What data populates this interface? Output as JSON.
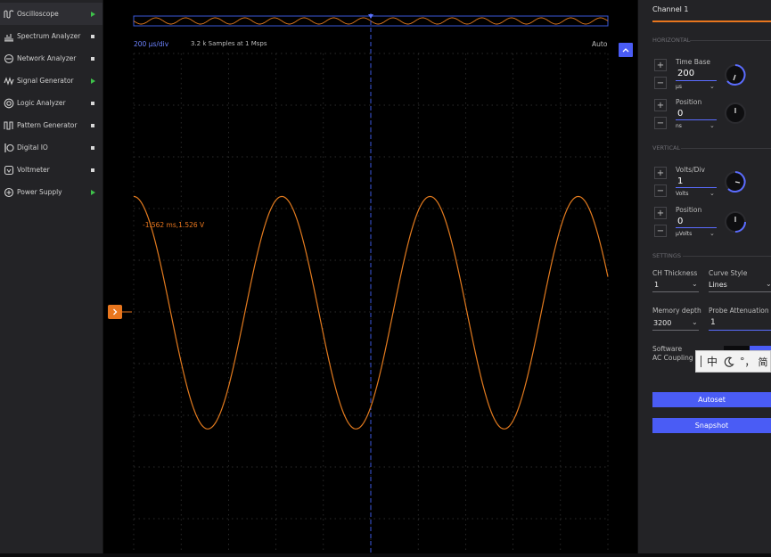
{
  "sidebar": {
    "items": [
      {
        "label": "Oscilloscope",
        "icon": "oscilloscope-icon",
        "status": "running"
      },
      {
        "label": "Spectrum Analyzer",
        "icon": "spectrum-icon",
        "status": "stopped"
      },
      {
        "label": "Network Analyzer",
        "icon": "network-icon",
        "status": "stopped"
      },
      {
        "label": "Signal Generator",
        "icon": "signal-generator-icon",
        "status": "running"
      },
      {
        "label": "Logic Analyzer",
        "icon": "logic-analyzer-icon",
        "status": "stopped"
      },
      {
        "label": "Pattern Generator",
        "icon": "pattern-generator-icon",
        "status": "stopped"
      },
      {
        "label": "Digital IO",
        "icon": "digital-io-icon",
        "status": "stopped"
      },
      {
        "label": "Voltmeter",
        "icon": "voltmeter-icon",
        "status": "stopped"
      },
      {
        "label": "Power Supply",
        "icon": "power-supply-icon",
        "status": "running"
      }
    ]
  },
  "plot": {
    "time_div": "200 µs/div",
    "samples": "3.2 k Samples at 1 Msps",
    "trigger_mode": "Auto",
    "cursor_readout": "-1.562 ms,1.526 V",
    "colors": {
      "trace": "#e27a1e",
      "accent": "#4a5cf5",
      "marker": "#e8761e"
    },
    "waveform": {
      "periods_in_view": 3.2,
      "phase_fraction": 0.5,
      "amplitude_fraction": 0.42,
      "center_fraction": 0.565
    }
  },
  "panel": {
    "title": "Channel 1",
    "horizontal": {
      "header": "HORIZONTAL",
      "time_base_label": "Time Base",
      "time_base_value": "200",
      "time_base_unit": "µs",
      "position_label": "Position",
      "position_value": "0",
      "position_unit": "ns"
    },
    "vertical": {
      "header": "VERTICAL",
      "volts_label": "Volts/Div",
      "volts_value": "1",
      "volts_unit": "Volts",
      "position_label": "Position",
      "position_value": "0",
      "position_unit": "µVolts"
    },
    "settings": {
      "header": "SETTINGS",
      "thickness_label": "CH Thickness",
      "thickness_value": "1",
      "curve_label": "Curve Style",
      "curve_value": "Lines",
      "memory_label": "Memory depth",
      "memory_value": "3200",
      "probe_label": "Probe Attenuation",
      "probe_value": "1",
      "software_label": "Software",
      "ac_label": "AC Coupling"
    },
    "autoset_label": "Autoset",
    "snapshot_label": "Snapshot"
  },
  "ime": {
    "chars": [
      "中",
      "°",
      "，",
      "简"
    ]
  }
}
